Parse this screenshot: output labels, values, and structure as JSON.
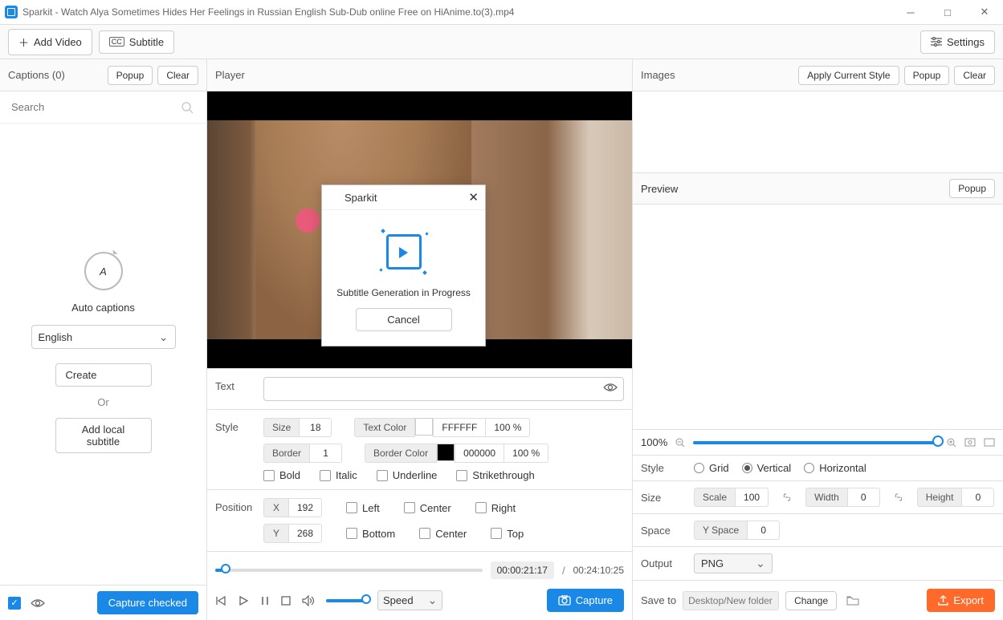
{
  "window": {
    "title": "Sparkit - Watch Alya Sometimes Hides Her Feelings in Russian English Sub-Dub online Free on HiAnime.to(3).mp4"
  },
  "toolbar": {
    "add_video": "Add Video",
    "subtitle": "Subtitle",
    "settings": "Settings"
  },
  "captions": {
    "title": "Captions (0)",
    "popup": "Popup",
    "clear": "Clear",
    "search_placeholder": "Search",
    "auto_label": "Auto captions",
    "language": "English",
    "create": "Create",
    "or": "Or",
    "add_local": "Add local subtitle",
    "capture_checked": "Capture checked"
  },
  "player": {
    "title": "Player",
    "text_label": "Text",
    "style": {
      "label": "Style",
      "size_tag": "Size",
      "size_val": "18",
      "textcolor_tag": "Text Color",
      "textcolor_val": "FFFFFF",
      "textcolor_pct": "100 %",
      "border_tag": "Border",
      "border_val": "1",
      "bordercolor_tag": "Border Color",
      "bordercolor_val": "000000",
      "bordercolor_pct": "100 %",
      "bold": "Bold",
      "italic": "Italic",
      "underline": "Underline",
      "strike": "Strikethrough"
    },
    "position": {
      "label": "Position",
      "x_tag": "X",
      "x_val": "192",
      "y_tag": "Y",
      "y_val": "268",
      "left": "Left",
      "center": "Center",
      "right": "Right",
      "bottom": "Bottom",
      "center2": "Center",
      "top": "Top"
    },
    "time_current": "00:00:21:17",
    "time_total": "00:24:10:25",
    "speed": "Speed",
    "capture": "Capture"
  },
  "modal": {
    "title": "Sparkit",
    "message": "Subtitle Generation in Progress",
    "cancel": "Cancel"
  },
  "images": {
    "title": "Images",
    "apply": "Apply Current Style",
    "popup": "Popup",
    "clear": "Clear",
    "preview": "Preview",
    "preview_popup": "Popup",
    "zoom": "100%",
    "style_label": "Style",
    "grid": "Grid",
    "vertical": "Vertical",
    "horizontal": "Horizontal",
    "size_label": "Size",
    "scale_tag": "Scale",
    "scale_val": "100",
    "width_tag": "Width",
    "width_val": "0",
    "height_tag": "Height",
    "height_val": "0",
    "space_label": "Space",
    "yspace_tag": "Y Space",
    "yspace_val": "0",
    "output_label": "Output",
    "output_fmt": "PNG",
    "saveto_label": "Save to",
    "path": "Desktop/New folder",
    "change": "Change",
    "export": "Export"
  }
}
